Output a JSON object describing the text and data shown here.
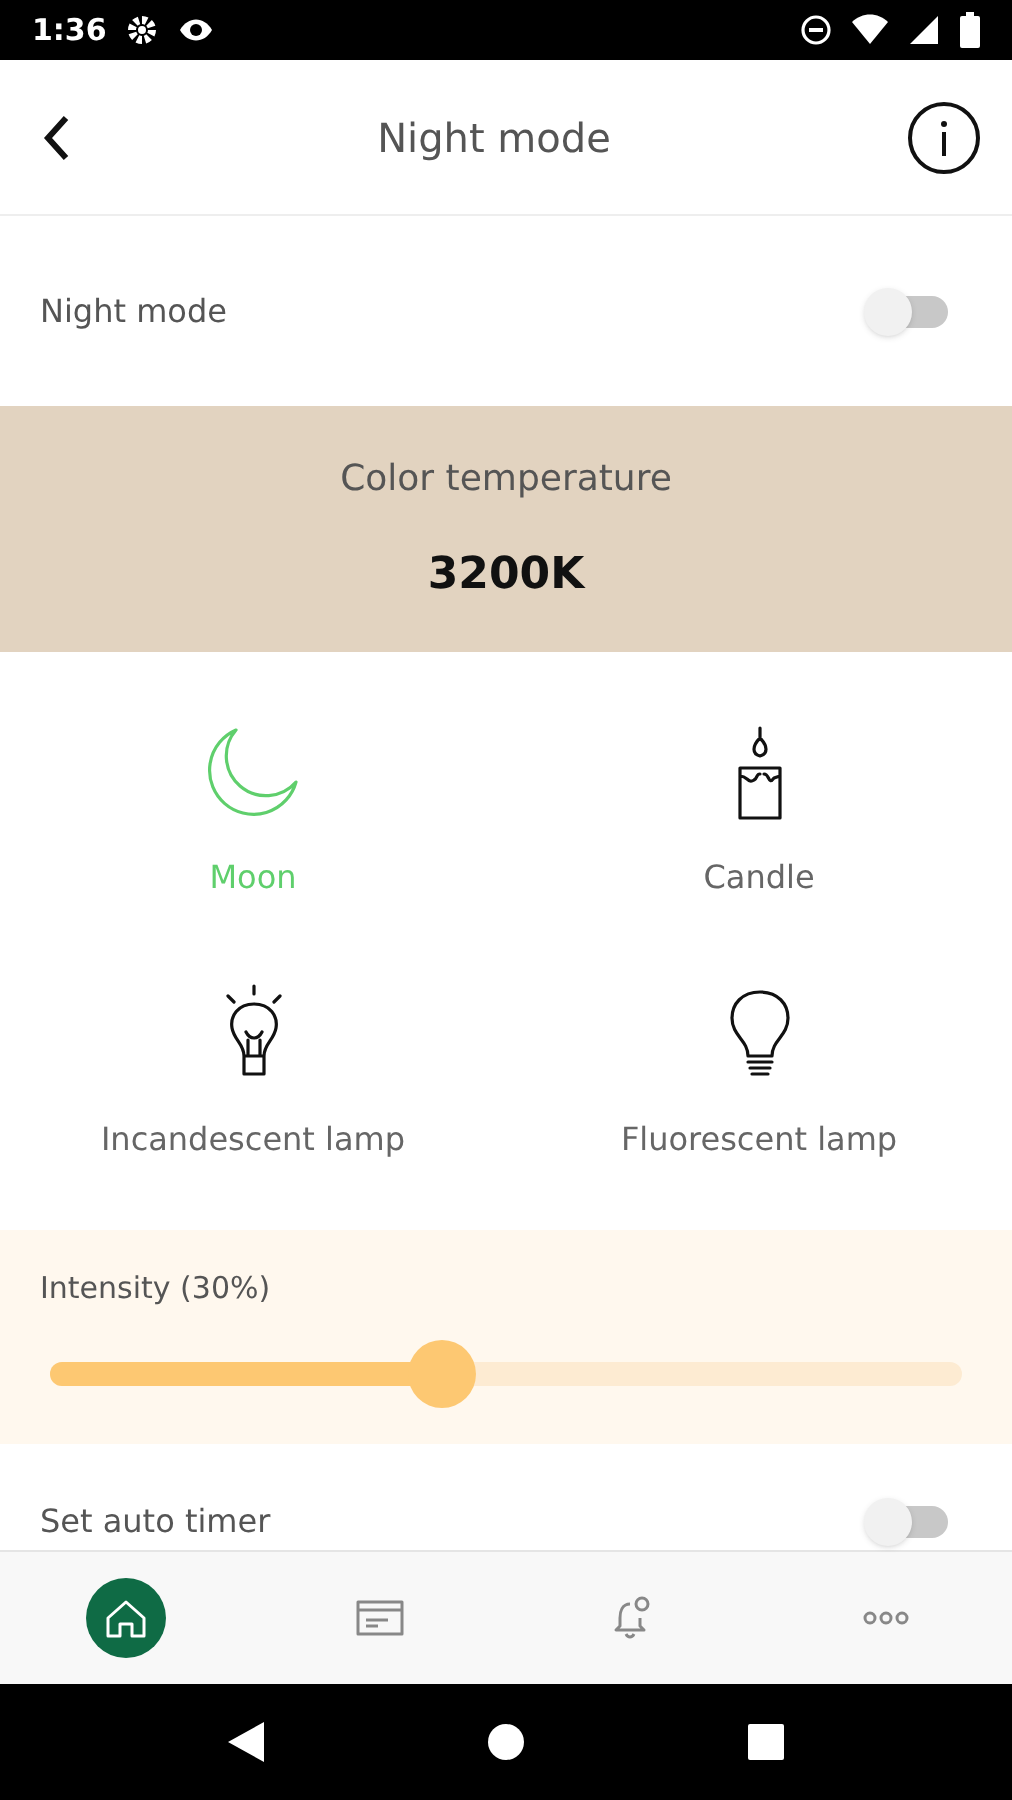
{
  "status_bar": {
    "time": "1:36"
  },
  "header": {
    "title": "Night mode"
  },
  "night_mode": {
    "label": "Night mode",
    "on": false
  },
  "color_temperature": {
    "label": "Color temperature",
    "value": "3200K"
  },
  "presets": [
    {
      "label": "Moon",
      "kind": "moon",
      "selected": true
    },
    {
      "label": "Candle",
      "kind": "candle",
      "selected": false
    },
    {
      "label": "Incandescent lamp",
      "kind": "incandescent",
      "selected": false
    },
    {
      "label": "Fluorescent lamp",
      "kind": "fluorescent",
      "selected": false
    }
  ],
  "intensity": {
    "label": "Intensity (30%)",
    "level": 0.43
  },
  "auto_timer": {
    "label": "Set auto timer",
    "on": false
  },
  "bottom_nav": [
    {
      "kind": "home",
      "selected": true
    },
    {
      "kind": "card",
      "selected": false
    },
    {
      "kind": "bell",
      "selected": false
    },
    {
      "kind": "more",
      "selected": false
    }
  ]
}
